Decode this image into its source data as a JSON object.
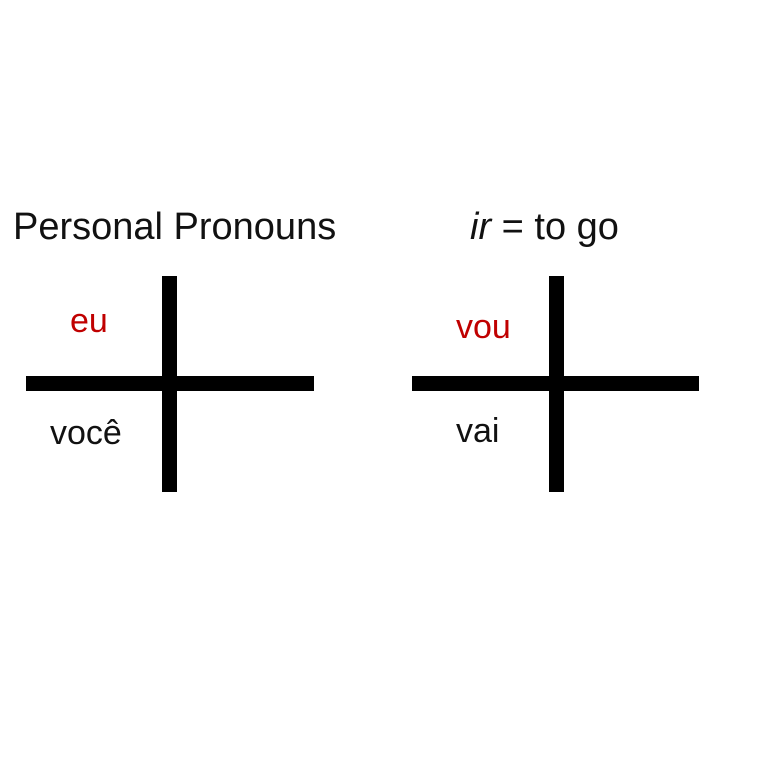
{
  "colors": {
    "highlight": "#c00000",
    "text": "#111111",
    "lines": "#000000",
    "background": "#ffffff"
  },
  "pronouns": {
    "title": "Personal Pronouns",
    "top_left": "eu",
    "bottom_left": "você"
  },
  "verb": {
    "title_verb": "ir",
    "title_rest": " = to go",
    "top_left": "vou",
    "bottom_left": "vai"
  }
}
